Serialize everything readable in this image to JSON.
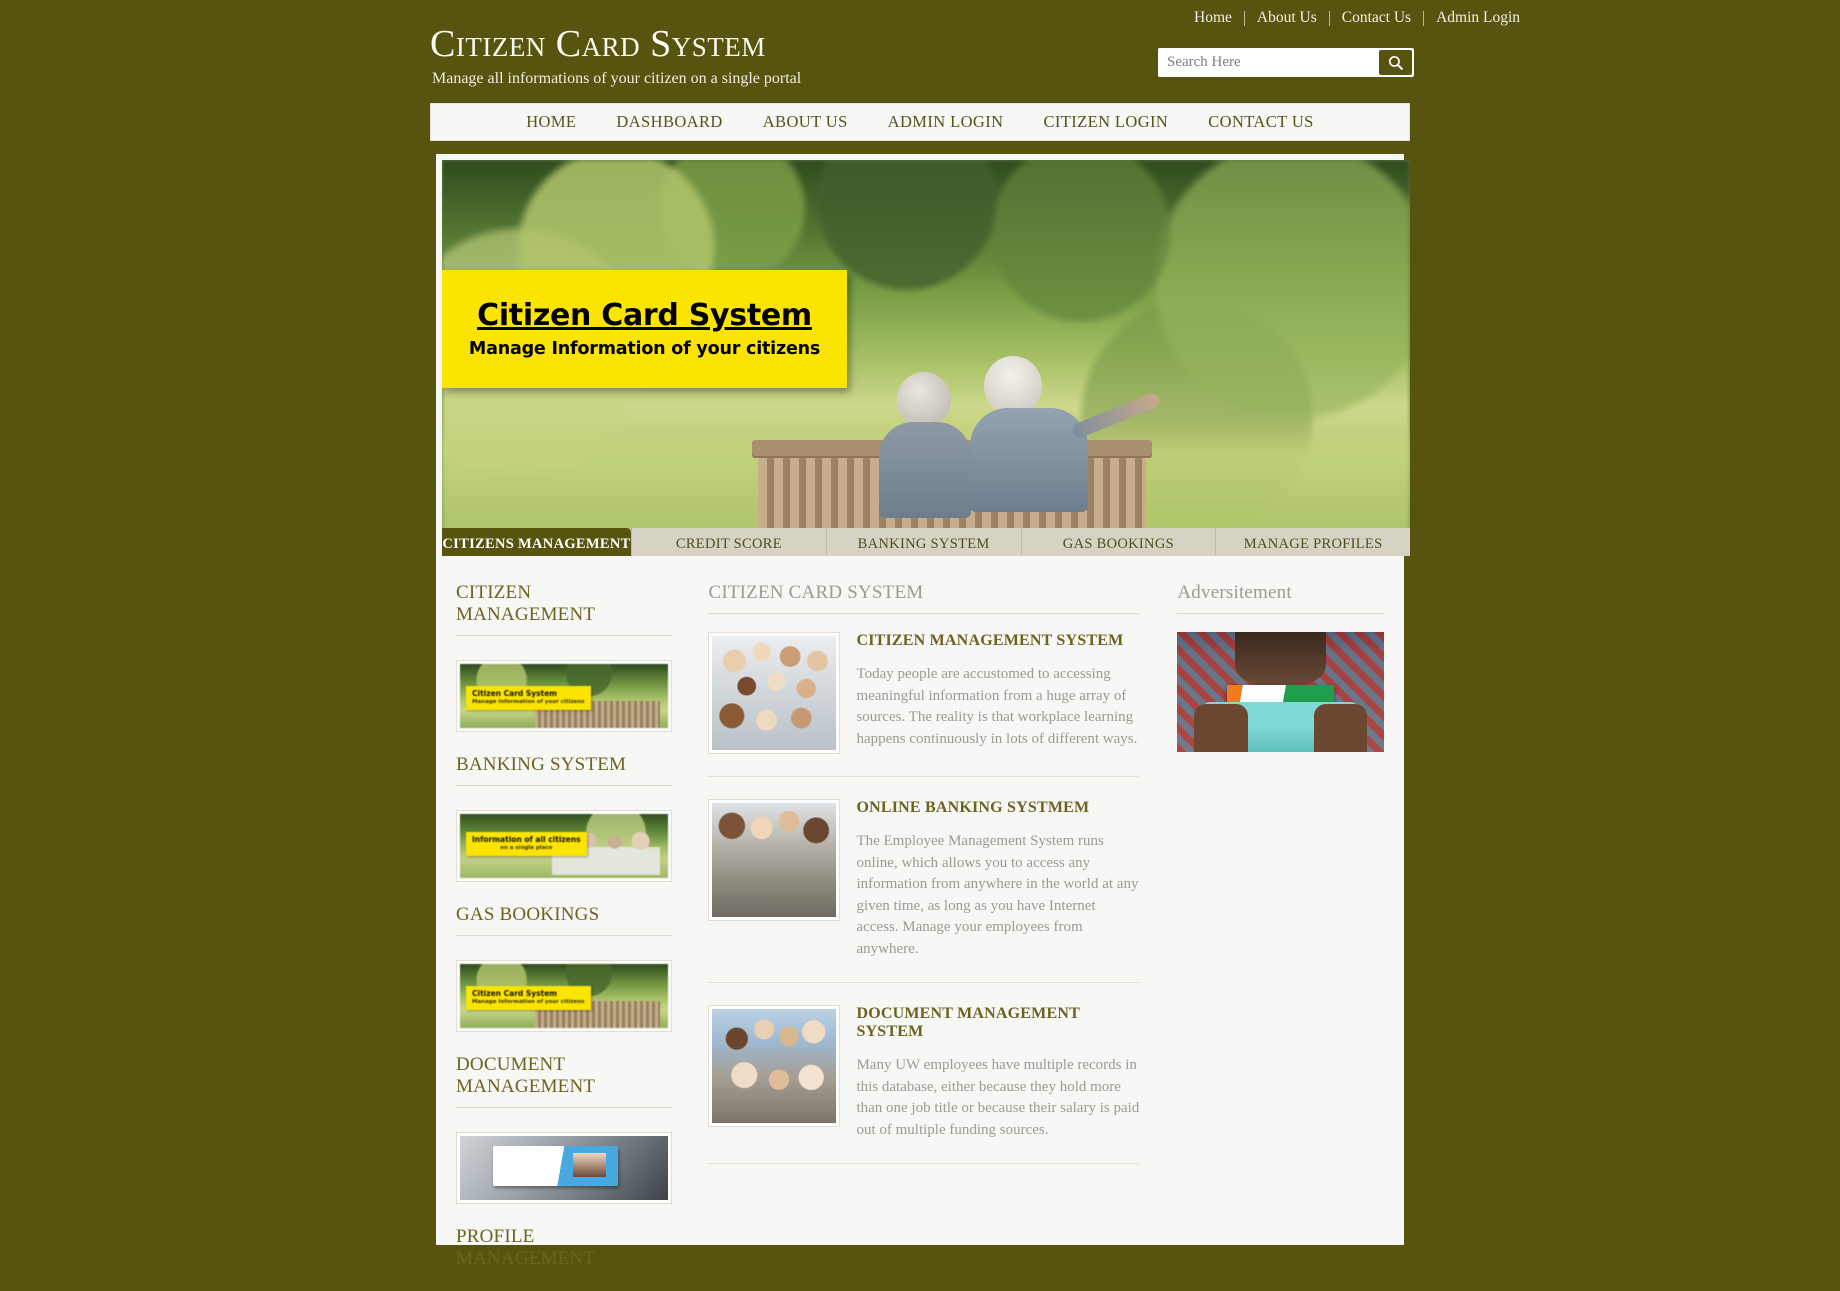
{
  "theme": {
    "olive": "#56540f",
    "page_bg": "#f7f7f5",
    "accent_yellow": "#fbe400",
    "heading_olive": "#6b6420",
    "muted_text": "#9c9a97"
  },
  "utility_nav": {
    "items": [
      {
        "label": "Home"
      },
      {
        "label": "About Us"
      },
      {
        "label": "Contact Us"
      },
      {
        "label": "Admin Login"
      }
    ]
  },
  "brand": {
    "title": "Citizen Card System",
    "tagline": "Manage all informations of your citizen on a single portal"
  },
  "search": {
    "placeholder": "Search Here",
    "value": "",
    "icon": "search-icon"
  },
  "main_nav": {
    "items": [
      {
        "label": "HOME"
      },
      {
        "label": "DASHBOARD"
      },
      {
        "label": "ABOUT US"
      },
      {
        "label": "ADMIN LOGIN"
      },
      {
        "label": "CITIZEN LOGIN"
      },
      {
        "label": "CONTACT US"
      }
    ]
  },
  "hero": {
    "banner_title": "Citizen Card System",
    "banner_subtitle": "Manage Information of your citizens"
  },
  "tabs": {
    "items": [
      {
        "label": "CITIZENS MANAGEMENT",
        "active": true
      },
      {
        "label": "CREDIT SCORE",
        "active": false
      },
      {
        "label": "BANKING SYSTEM",
        "active": false
      },
      {
        "label": "GAS BOOKINGS",
        "active": false
      },
      {
        "label": "MANAGE PROFILES",
        "active": false
      }
    ]
  },
  "left_column": {
    "sections": [
      {
        "heading": "CITIZEN MANAGEMENT",
        "thumb_label": "Citizen Card System",
        "thumb_sublabel": "Manage Information of your citizens"
      },
      {
        "heading": "BANKING SYSTEM",
        "thumb_label": "Information of all citizens",
        "thumb_sublabel": "on a single place"
      },
      {
        "heading": "GAS BOOKINGS",
        "thumb_label": "Citizen Card System",
        "thumb_sublabel": "Manage Information of your citizens"
      },
      {
        "heading": "DOCUMENT MANAGEMENT",
        "thumb_label": "",
        "thumb_sublabel": ""
      },
      {
        "heading": "PROFILE MANAGEMENT",
        "thumb_label": "",
        "thumb_sublabel": ""
      }
    ]
  },
  "middle_column": {
    "heading": "CITIZEN CARD SYSTEM",
    "articles": [
      {
        "title": "CITIZEN MANAGEMENT SYSTEM",
        "text": "Today people are accustomed to accessing meaningful information from a huge array of sources. The reality is that workplace learning happens continuously in lots of different ways."
      },
      {
        "title": "ONLINE BANKING SYSTMEM",
        "text": "The Employee Management System runs online, which allows you to access any information from anywhere in the world at any given time, as long as you have Internet access. Manage your employees from anywhere."
      },
      {
        "title": "DOCUMENT MANAGEMENT SYSTEM",
        "text": "Many UW employees have multiple records in this database, either because they hold more than one job title or because their salary is paid out of multiple funding sources."
      }
    ]
  },
  "right_column": {
    "heading": "Adversitement"
  }
}
